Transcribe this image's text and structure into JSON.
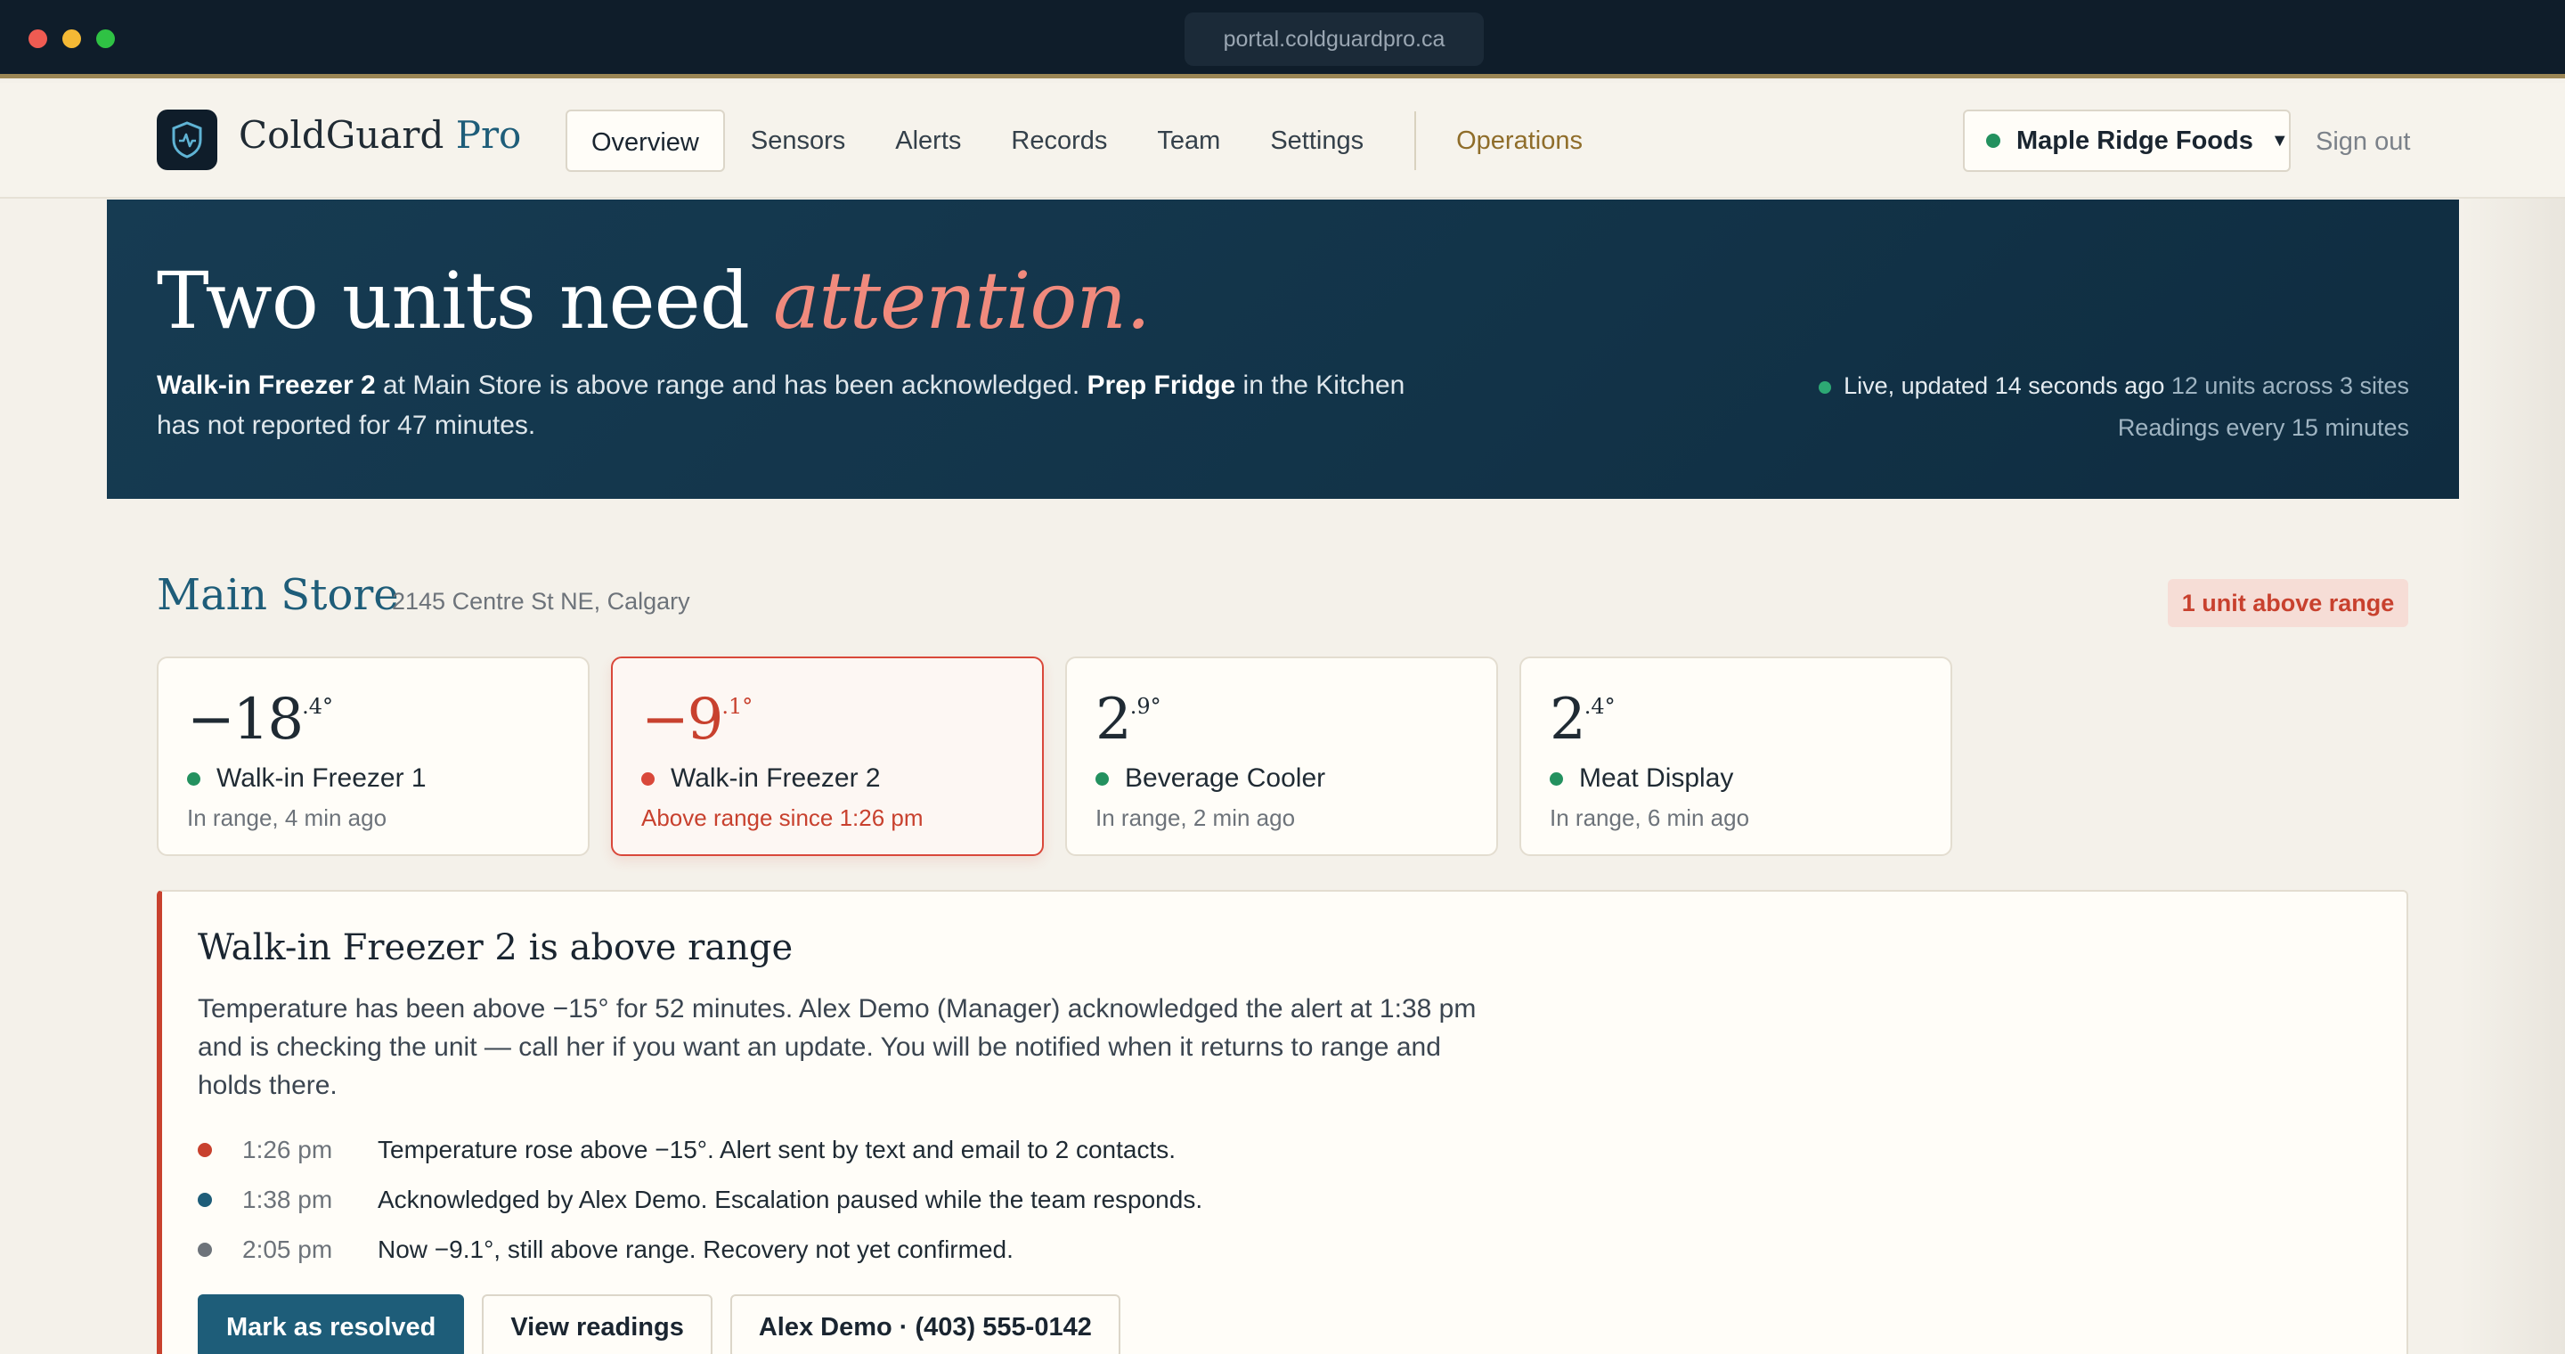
{
  "browser": {
    "url": "portal.coldguardpro.ca"
  },
  "app": {
    "brand_name": "ColdGuard",
    "brand_suffix": "Pro"
  },
  "nav": {
    "items": [
      {
        "label": "Overview"
      },
      {
        "label": "Sensors"
      },
      {
        "label": "Alerts"
      },
      {
        "label": "Records"
      },
      {
        "label": "Team"
      },
      {
        "label": "Settings"
      }
    ],
    "operations_label": "Operations",
    "org_label": "Maple Ridge Foods",
    "sign_out_label": "Sign out"
  },
  "hero": {
    "title_plain": "Two units need ",
    "title_accent": "attention.",
    "summary": {
      "unit_a": "Walk-in Freezer 2",
      "text_a": " at Main Store is above range and has been acknowledged. ",
      "unit_b": "Prep Fridge",
      "text_b": " in the Kitchen has not reported for 47 minutes."
    },
    "live_status": "Live, updated 14 seconds ago",
    "units_summary": "12 units across 3 sites",
    "cadence": "Readings every 15 minutes"
  },
  "store": {
    "name": "Main Store",
    "address": "2145 Centre St NE, Calgary",
    "badge": "1 unit above range",
    "units": [
      {
        "temp_whole": "−18",
        "temp_decimal": ".4°",
        "name": "Walk-in Freezer 1",
        "status": "In range, 4 min ago"
      },
      {
        "temp_whole": "−9",
        "temp_decimal": ".1°",
        "name": "Walk-in Freezer 2",
        "status": "Above range since 1:26 pm"
      },
      {
        "temp_whole": "2",
        "temp_decimal": ".9°",
        "name": "Beverage Cooler",
        "status": "In range, 2 min ago"
      },
      {
        "temp_whole": "2",
        "temp_decimal": ".4°",
        "name": "Meat Display",
        "status": "In range, 6 min ago"
      }
    ]
  },
  "incident": {
    "title": "Walk-in Freezer 2 is above range",
    "description": "Temperature has been above −15° for 52 minutes. Alex Demo (Manager) acknowledged the alert at 1:38 pm and is checking the unit — call her if you want an update. You will be notified when it returns to range and holds there.",
    "timeline": [
      {
        "time": "1:26 pm",
        "text": "Temperature rose above −15°. Alert sent by text and email to 2 contacts.",
        "color": "#c8412e"
      },
      {
        "time": "1:38 pm",
        "text": "Acknowledged by Alex Demo. Escalation paused while the team responds.",
        "color": "#1e5d79"
      },
      {
        "time": "2:05 pm",
        "text": "Now −9.1°, still above range. Recovery not yet confirmed.",
        "color": "#6d737a"
      }
    ],
    "actions": {
      "resolve": "Mark as resolved",
      "view_readings": "View readings",
      "contact": "Alex Demo · (403) 555-0142"
    }
  },
  "colors": {
    "accent": "#1e5d79",
    "alert": "#c8412e",
    "ok": "#23915f",
    "hero_bg": "#163b52"
  }
}
